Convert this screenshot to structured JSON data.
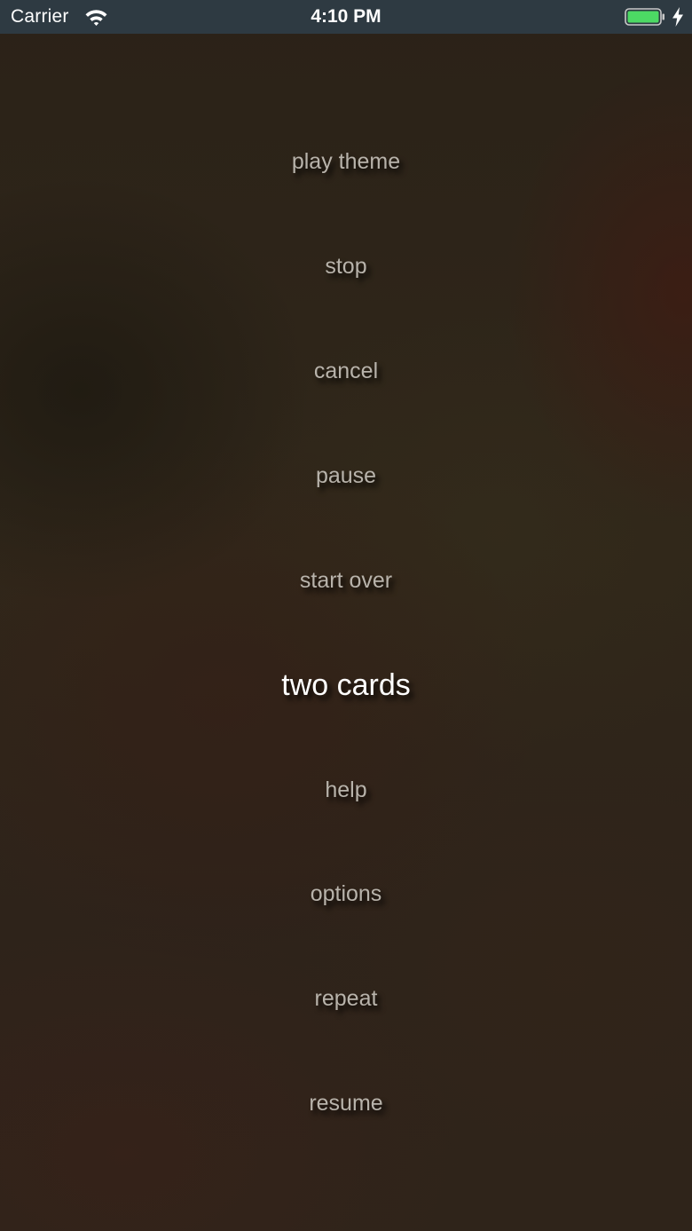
{
  "status_bar": {
    "carrier": "Carrier",
    "time": "4:10 PM",
    "battery_color": "#4cd964",
    "background_color": "#2e3a42"
  },
  "menu": {
    "items": [
      {
        "label": "play theme",
        "selected": false
      },
      {
        "label": "stop",
        "selected": false
      },
      {
        "label": "cancel",
        "selected": false
      },
      {
        "label": "pause",
        "selected": false
      },
      {
        "label": "start over",
        "selected": false
      },
      {
        "label": "two cards",
        "selected": true
      },
      {
        "label": "help",
        "selected": false
      },
      {
        "label": "options",
        "selected": false
      },
      {
        "label": "repeat",
        "selected": false
      },
      {
        "label": "resume",
        "selected": false
      }
    ]
  },
  "icons": {
    "wifi": "wifi-icon",
    "battery": "battery-icon",
    "charging": "charging-bolt-icon"
  }
}
